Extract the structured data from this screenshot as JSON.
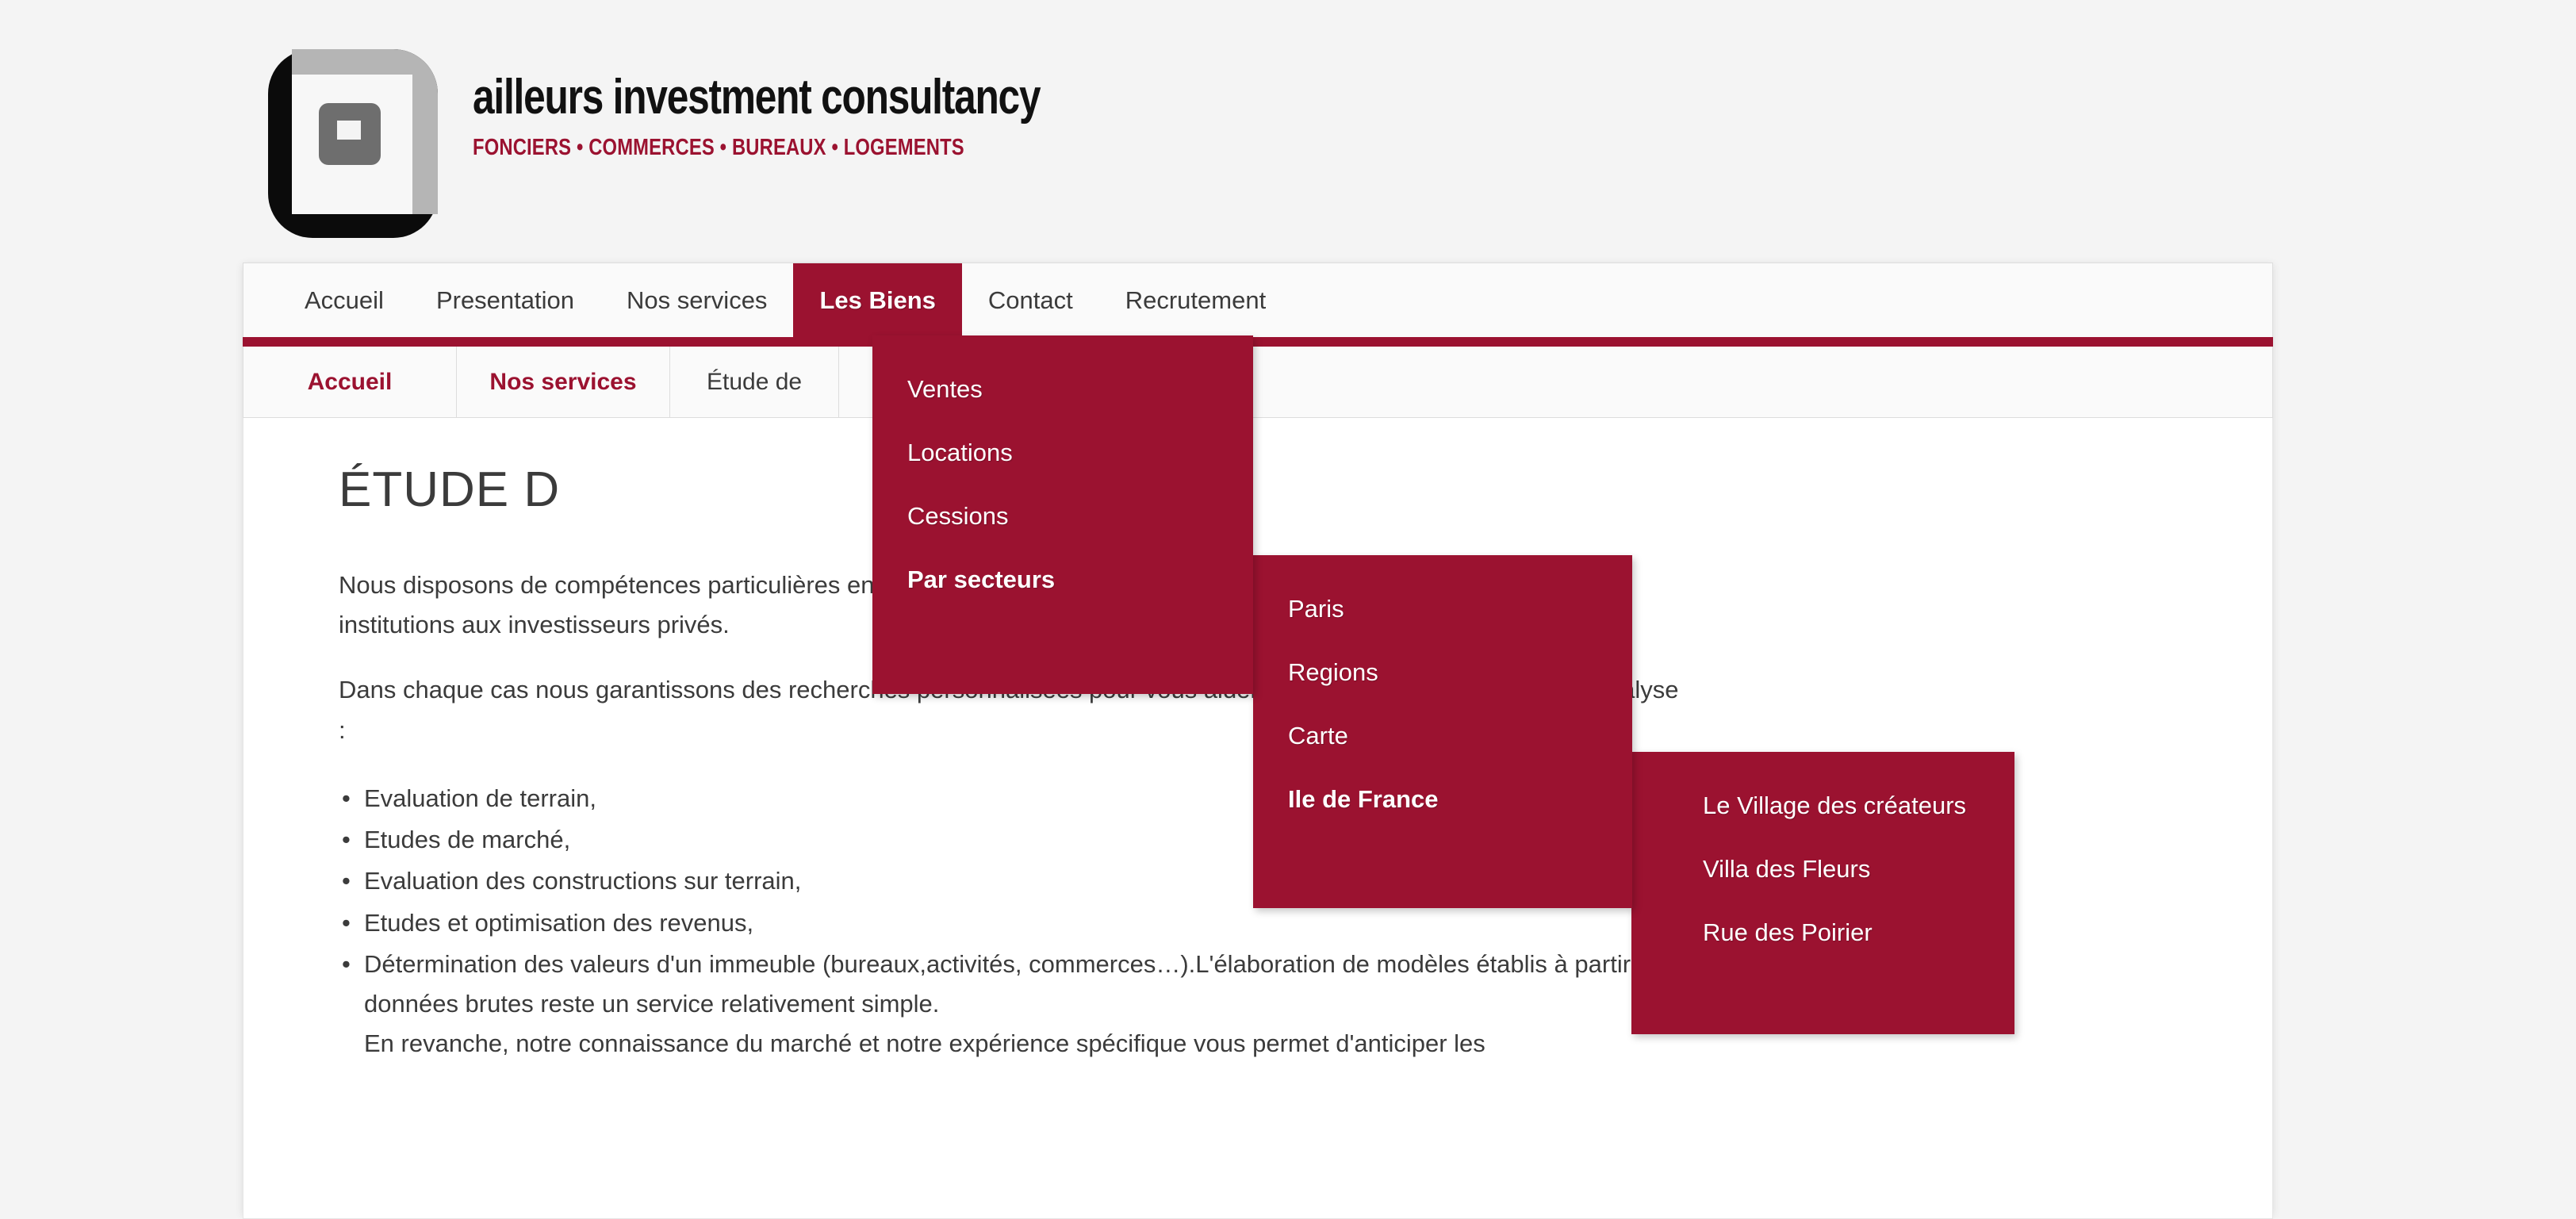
{
  "brand": {
    "name": "ailleurs investment consultancy",
    "tagline": "FONCIERS • COMMERCES • BUREAUX • LOGEMENTS",
    "logo_colors": {
      "black": "#0b0b0b",
      "light_gray": "#b5b5b5",
      "mid_gray": "#6e6e6e",
      "white": "#f7f7f7"
    }
  },
  "theme": {
    "accent": "#9b1230",
    "page_background": "#f4f4f4",
    "bar_background": "#fafafa",
    "content_background": "#ffffff",
    "text": "#3b3b3b"
  },
  "nav": {
    "items": [
      {
        "label": "Accueil",
        "active": false
      },
      {
        "label": "Presentation",
        "active": false
      },
      {
        "label": "Nos services",
        "active": false
      },
      {
        "label": "Les Biens",
        "active": true
      },
      {
        "label": "Contact",
        "active": false
      },
      {
        "label": "Recrutement",
        "active": false
      }
    ]
  },
  "breadcrumb": {
    "items": [
      {
        "label": "Accueil",
        "type": "link"
      },
      {
        "label": "Nos services",
        "type": "link"
      },
      {
        "label": "Étude de",
        "type": "current"
      }
    ]
  },
  "dropdowns": {
    "level1": {
      "parent": "Les Biens",
      "items": [
        {
          "label": "Ventes",
          "bold": false
        },
        {
          "label": "Locations",
          "bold": false
        },
        {
          "label": "Cessions",
          "bold": false
        },
        {
          "label": "Par secteurs",
          "bold": true
        }
      ]
    },
    "level2": {
      "parent": "Par secteurs",
      "items": [
        {
          "label": "Paris",
          "bold": false
        },
        {
          "label": "Regions",
          "bold": false
        },
        {
          "label": "Carte",
          "bold": false
        },
        {
          "label": "Ile de France",
          "bold": true
        }
      ]
    },
    "level3": {
      "parent": "Ile de France",
      "items": [
        {
          "label": "Le Village des créateurs",
          "bold": false
        },
        {
          "label": "Villa des Fleurs",
          "bold": false
        },
        {
          "label": "Rue des Poirier",
          "bold": false
        }
      ]
    }
  },
  "main": {
    "title": "ÉTUDE D",
    "paragraphs": [
      "Nous disposons de compétences particulières en matière d'investissement et nos secteurs s'étendent des grandes institutions aux investisseurs privés.",
      "Dans chaque cas nous garantissons des recherches personnalisées pour vous aider à investir, grâce à nos outils d'analyse :"
    ],
    "bullets": [
      {
        "text": "Evaluation de terrain,"
      },
      {
        "text": "Etudes de marché,"
      },
      {
        "text": "Evaluation des constructions sur terrain,"
      },
      {
        "text": "Etudes et optimisation des revenus,"
      },
      {
        "text": "Détermination des valeurs d'un immeuble (bureaux,activités, commerces…).L'élaboration de modèles établis à partir de données brutes reste un service relativement simple.",
        "sub": "En revanche, notre connaissance du marché et notre expérience spécifique vous permet d'anticiper les"
      }
    ]
  }
}
